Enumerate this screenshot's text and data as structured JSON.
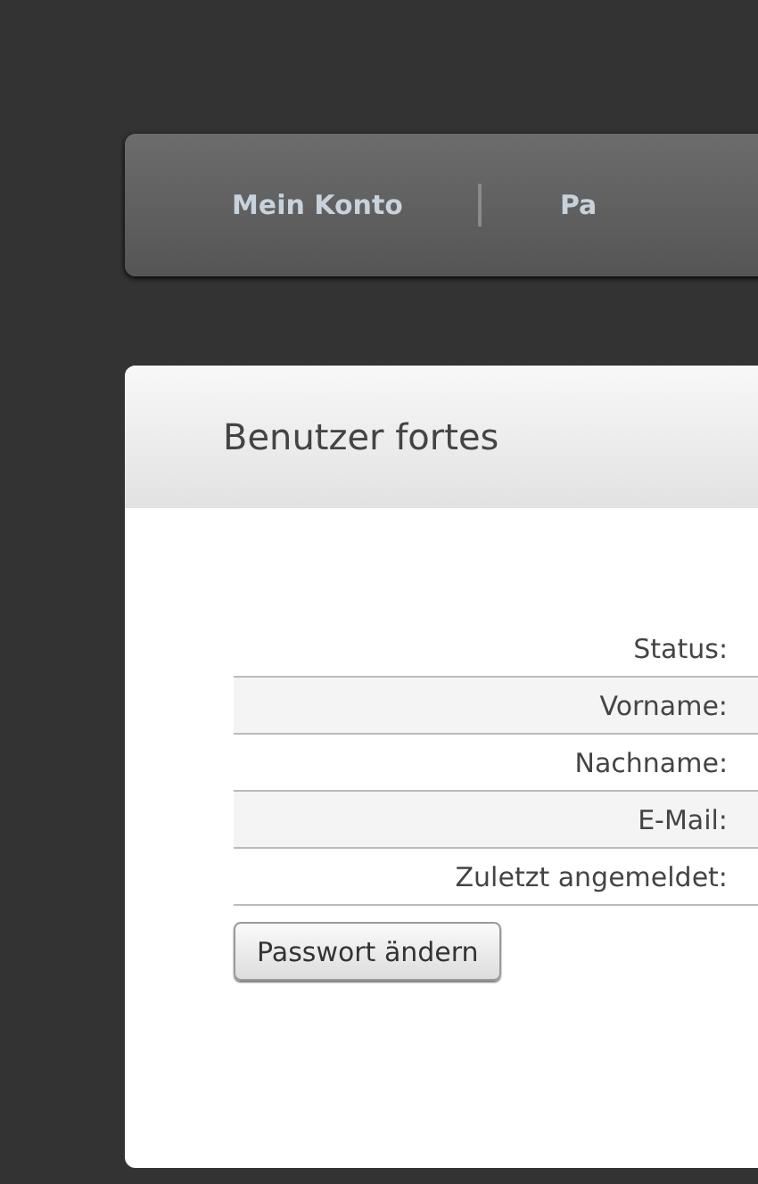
{
  "nav": {
    "items": [
      {
        "label": "Mein Konto"
      },
      {
        "label": "Pa"
      }
    ]
  },
  "card": {
    "title": "Benutzer fortes",
    "rows": [
      {
        "label": "Status:"
      },
      {
        "label": "Vorname:"
      },
      {
        "label": "Nachname:"
      },
      {
        "label": "E-Mail:"
      },
      {
        "label": "Zuletzt angemeldet:"
      }
    ],
    "button": "Passwort ändern"
  }
}
